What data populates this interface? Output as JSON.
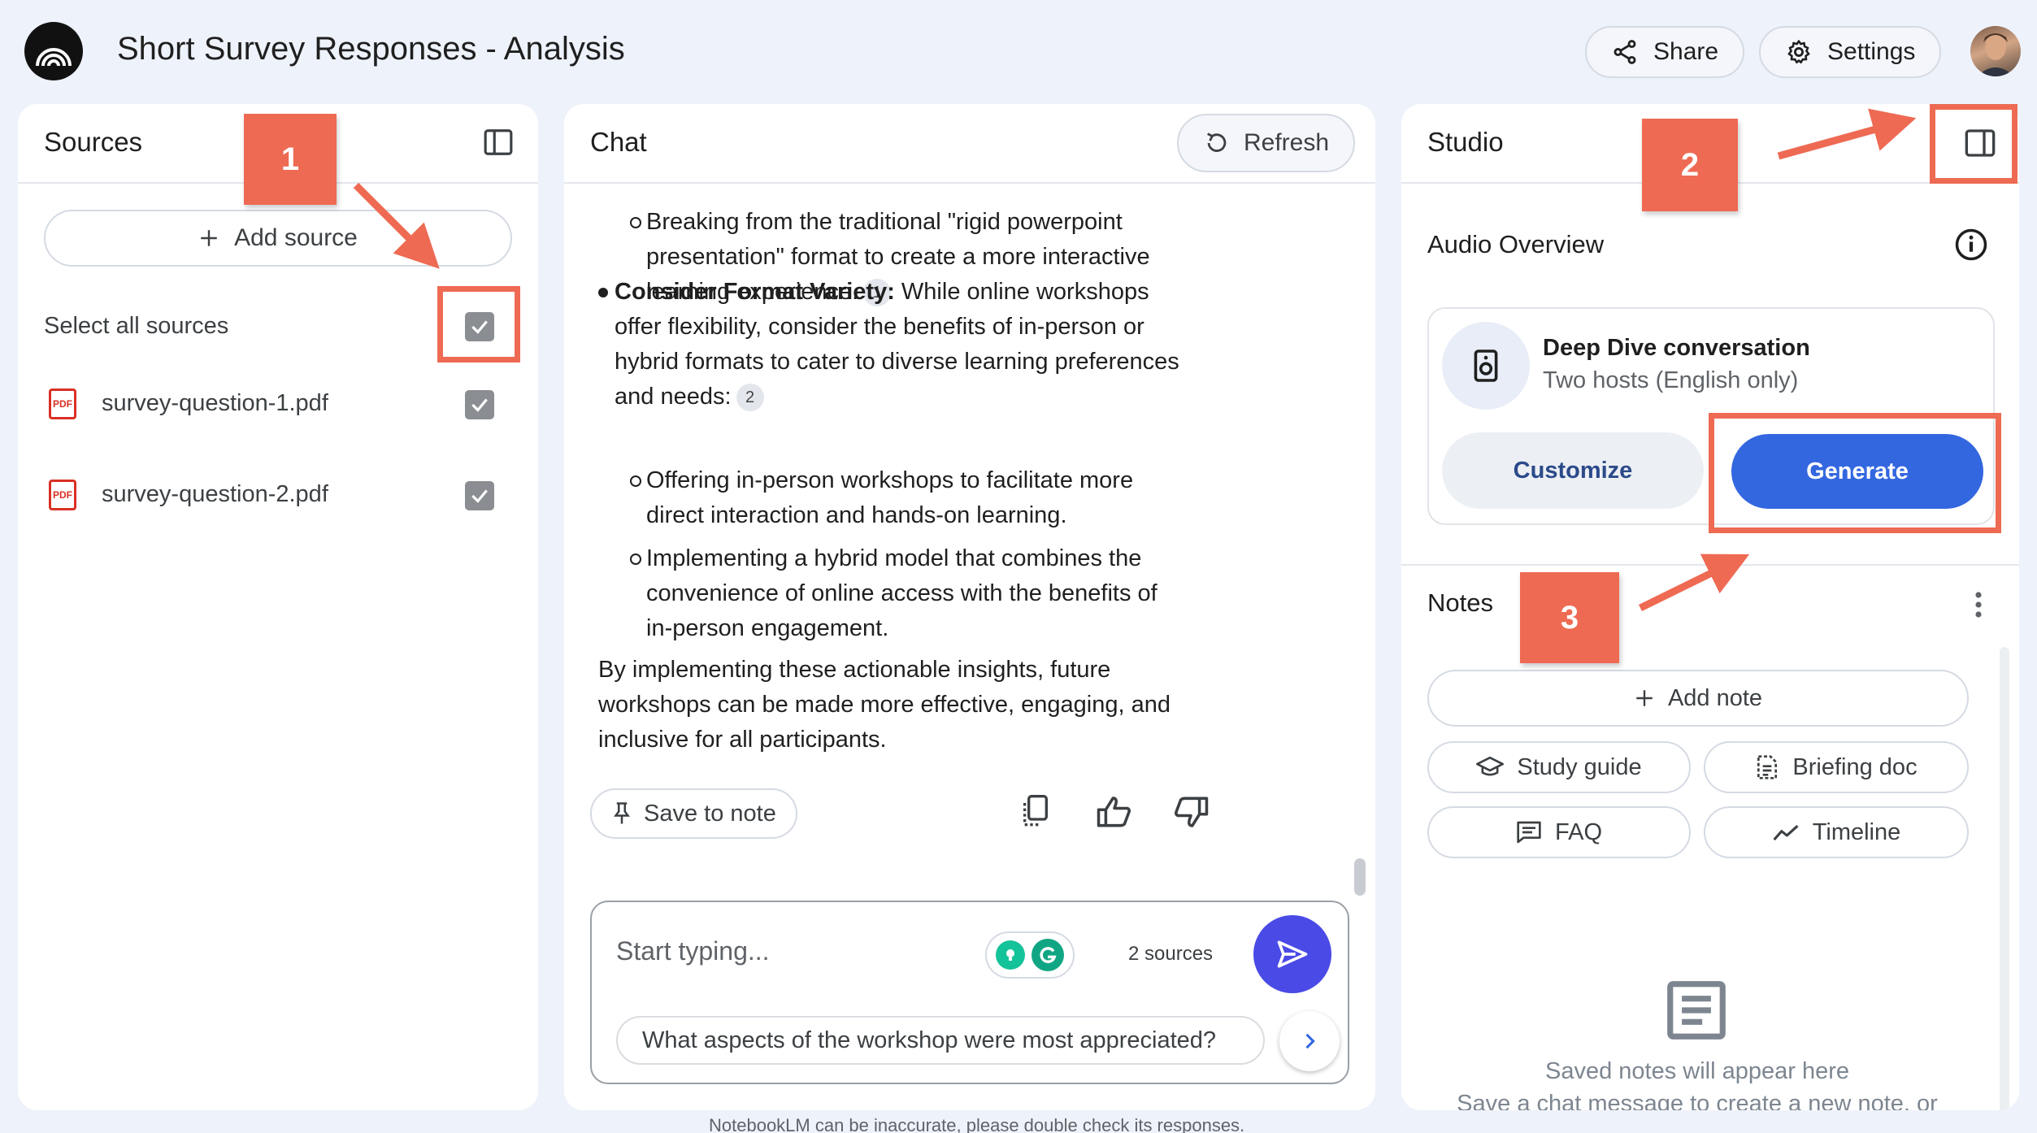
{
  "header": {
    "title": "Short Survey Responses - Analysis",
    "share_label": "Share",
    "settings_label": "Settings"
  },
  "sources": {
    "title": "Sources",
    "add_source_label": "Add source",
    "select_all_label": "Select all sources",
    "items": [
      {
        "name": "survey-question-1.pdf",
        "checked": true
      },
      {
        "name": "survey-question-2.pdf",
        "checked": true
      }
    ]
  },
  "chat": {
    "title": "Chat",
    "refresh_label": "Refresh",
    "lines": {
      "b1_l1": "Breaking from the traditional \"rigid powerpoint",
      "b1_l2": "presentation\" format to create a more interactive",
      "b1_l3": "learning experience.",
      "b1_cite": "1",
      "b2_bold": "Consider Format Variety:",
      "b2_l1": " While online workshops",
      "b2_l2": "offer flexibility, consider the benefits of in-person or",
      "b2_l3": "hybrid formats to cater to diverse learning preferences",
      "b2_l4": "and needs:",
      "b2_cite": "2",
      "s1_l1": "Offering in-person workshops to facilitate more",
      "s1_l2": "direct interaction and hands-on learning.",
      "s2_l1": "Implementing a hybrid model that combines the",
      "s2_l2": "convenience of online access with the benefits of",
      "s2_l3": "in-person engagement.",
      "p_l1": "By implementing these actionable insights, future",
      "p_l2": "workshops can be made more effective, engaging, and",
      "p_l3": "inclusive for all participants."
    },
    "save_to_note_label": "Save to note",
    "input_placeholder": "Start typing...",
    "sources_count": "2 sources",
    "suggestion": "What aspects of the workshop were most appreciated?",
    "disclaimer": "NotebookLM can be inaccurate, please double check its responses."
  },
  "studio": {
    "title": "Studio",
    "audio_overview_label": "Audio Overview",
    "deep_dive_title": "Deep Dive conversation",
    "deep_dive_subtitle": "Two hosts (English only)",
    "customize_label": "Customize",
    "generate_label": "Generate",
    "notes_label": "Notes",
    "add_note_label": "Add note",
    "study_guide_label": "Study guide",
    "briefing_doc_label": "Briefing doc",
    "faq_label": "FAQ",
    "timeline_label": "Timeline",
    "empty_title": "Saved notes will appear here",
    "empty_subtitle": "Save a chat message to create a new note, or"
  },
  "annotations": {
    "callout_1": "1",
    "callout_2": "2",
    "callout_3": "3",
    "color": "#ee6a53"
  },
  "colors": {
    "page_bg": "#eef2fa",
    "primary_blue": "#3367e0",
    "send_button": "#4a4ae6"
  }
}
